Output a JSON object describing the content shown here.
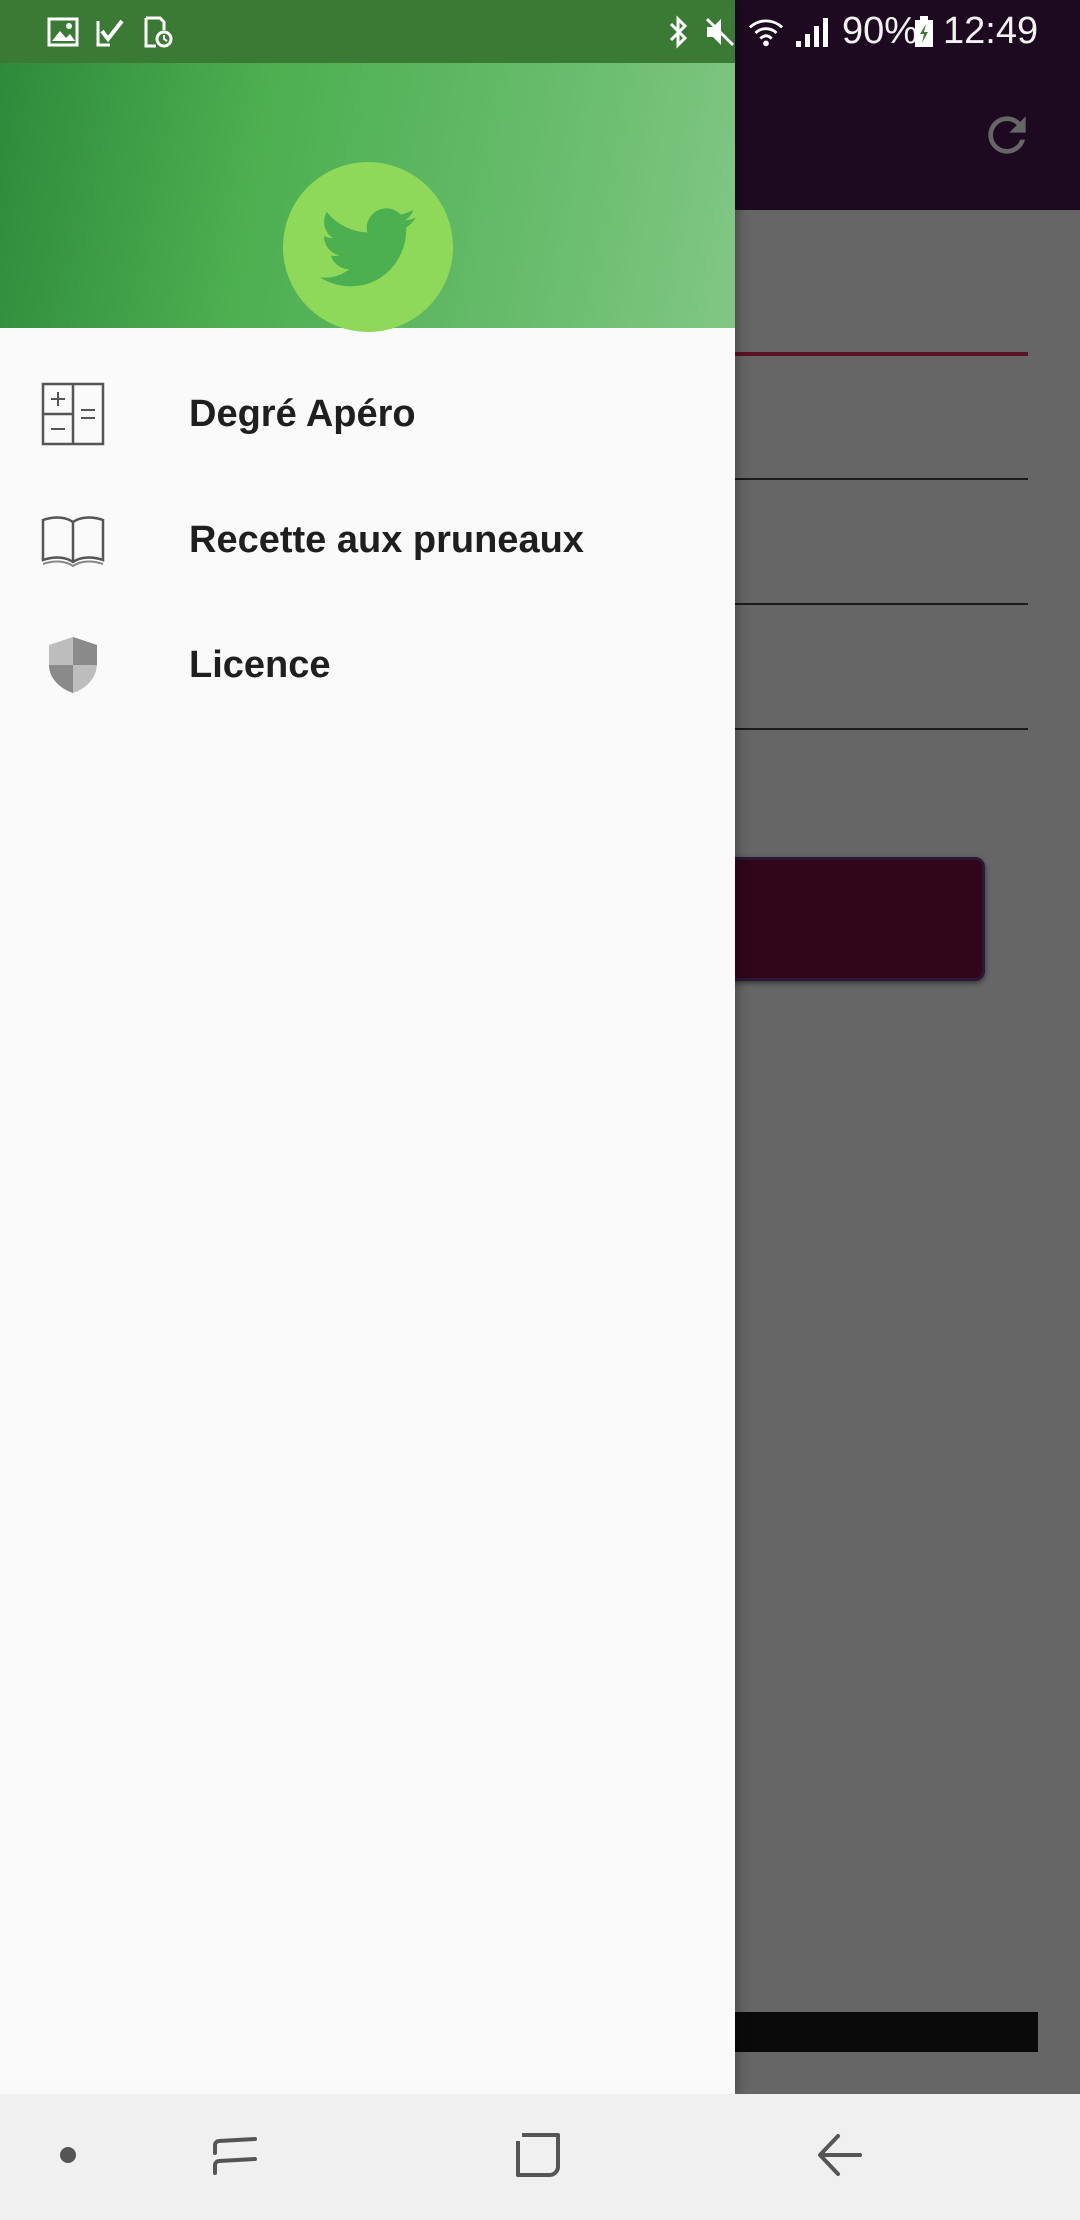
{
  "status_bar": {
    "battery_percent": "90%",
    "time": "12:49",
    "left_icons": [
      "gallery-icon",
      "task-done-icon",
      "screen-record-icon"
    ],
    "right_icons": [
      "bluetooth-icon",
      "mute-icon",
      "wifi-icon",
      "signal-icon",
      "battery-charging-icon"
    ]
  },
  "drawer": {
    "header": {
      "avatar_icon": "twitter-bird-icon",
      "colors": {
        "gradient_start": "#2e8a3b",
        "gradient_end": "#81c784",
        "avatar_bg": "#8fd95a"
      }
    },
    "items": [
      {
        "label": "Degré Apéro",
        "icon": "calculator-icon"
      },
      {
        "label": "Recette aux pruneaux",
        "icon": "open-book-icon"
      },
      {
        "label": "Licence",
        "icon": "shield-icon"
      }
    ]
  },
  "app": {
    "toolbar_color": "#4a1a50",
    "toolbar_icon": "refresh-icon",
    "accent_color": "#e0315f",
    "button_color": "#7a1040"
  },
  "nav_bar": {
    "buttons": [
      "dot-icon",
      "recent-apps-icon",
      "home-icon",
      "back-icon"
    ]
  }
}
